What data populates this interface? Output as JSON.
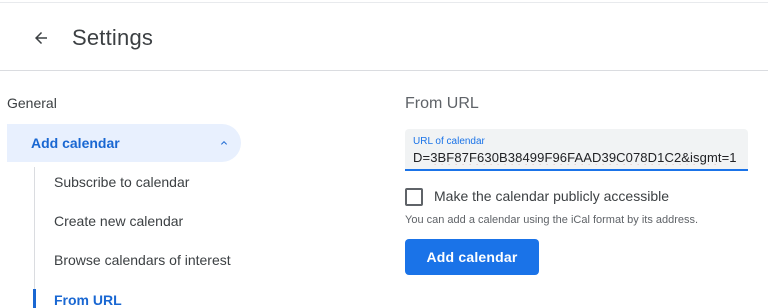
{
  "header": {
    "title": "Settings",
    "back_icon": "arrow-back-icon"
  },
  "sidebar": {
    "general_label": "General",
    "add_calendar": {
      "label": "Add calendar",
      "expanded": true,
      "icon": "chevron-up-icon"
    },
    "sub_items": [
      {
        "label": "Subscribe to calendar"
      },
      {
        "label": "Create new calendar"
      },
      {
        "label": "Browse calendars of interest"
      },
      {
        "label": "From URL",
        "selected": true
      }
    ]
  },
  "main": {
    "section_title": "From URL",
    "url_field": {
      "label": "URL of calendar",
      "value_prefix": "D=",
      "value_middle": "3BF87F630B38499F96FAAD39C078D1C2&isgmt",
      "value_suffix": "=1"
    },
    "checkbox": {
      "label": "Make the calendar publicly accessible",
      "checked": false
    },
    "helper_text": "You can add a calendar using the iCal format by its address.",
    "add_button_label": "Add calendar"
  },
  "colors": {
    "accent": "#1a73e8",
    "selected_bg": "#e8f0fe",
    "selected_text": "#1967d2",
    "text": "#3c4043"
  }
}
